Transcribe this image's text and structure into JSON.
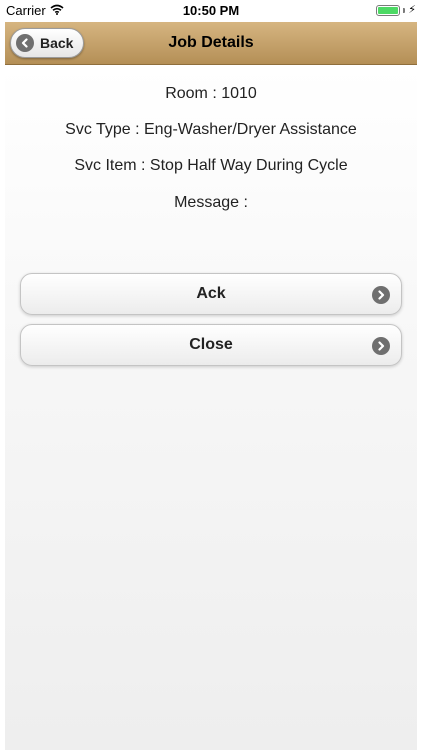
{
  "status_bar": {
    "carrier": "Carrier",
    "time": "10:50 PM",
    "battery_icon": "battery-full-icon"
  },
  "nav": {
    "title": "Job Details",
    "back_label": "Back"
  },
  "job": {
    "room": "Room : 1010",
    "svc_type": "Svc Type : Eng-Washer/Dryer Assistance",
    "svc_item": "Svc Item : Stop Half Way During Cycle",
    "message": "Message :"
  },
  "actions": {
    "ack_label": "Ack",
    "close_label": "Close"
  },
  "colors": {
    "nav_bar": "#c4a06a",
    "button_icon": "#6f6f6f",
    "battery": "#4cd964"
  }
}
